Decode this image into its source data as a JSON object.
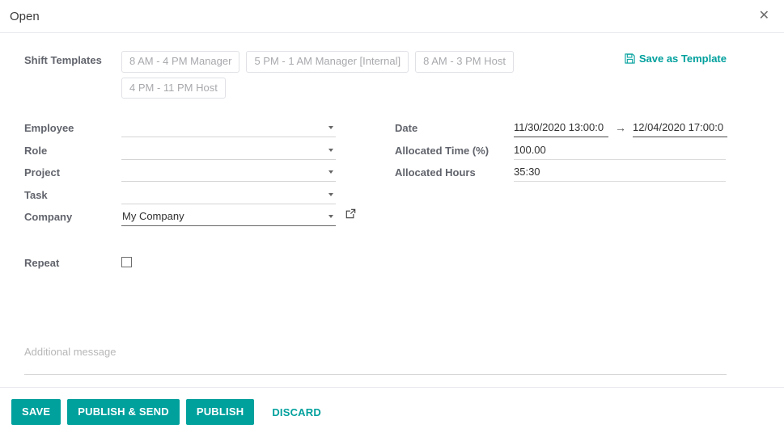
{
  "dialog": {
    "title": "Open",
    "close_icon": "close-icon",
    "close_glyph": "✕"
  },
  "shift_templates": {
    "label": "Shift Templates",
    "chips": [
      "8 AM - 4 PM Manager",
      "5 PM - 1 AM Manager [Internal]",
      "8 AM - 3 PM Host",
      "4 PM - 11 PM Host"
    ],
    "save_as_template": {
      "label": "Save as Template",
      "icon": "floppy-disk-save-icon"
    }
  },
  "form": {
    "left": [
      {
        "label": "Employee",
        "value": "",
        "type": "select"
      },
      {
        "label": "Role",
        "value": "",
        "type": "select"
      },
      {
        "label": "Project",
        "value": "",
        "type": "select"
      },
      {
        "label": "Task",
        "value": "",
        "type": "select"
      },
      {
        "label": "Company",
        "value": "My Company",
        "type": "select-filled"
      }
    ],
    "company_external_link_icon": "external-link-icon",
    "right": {
      "date": {
        "label": "Date",
        "start": "11/30/2020 13:00:0",
        "arrow": "→",
        "end": "12/04/2020 17:00:0"
      },
      "allocated_time": {
        "label": "Allocated Time (%)",
        "value": "100.00"
      },
      "allocated_hours": {
        "label": "Allocated Hours",
        "value": "35:30"
      }
    },
    "repeat": {
      "label": "Repeat",
      "checked": false
    },
    "message": {
      "placeholder": "Additional message"
    }
  },
  "footer": {
    "buttons": [
      {
        "label": "SAVE",
        "style": "primary"
      },
      {
        "label": "PUBLISH & SEND",
        "style": "primary"
      },
      {
        "label": "PUBLISH",
        "style": "primary"
      },
      {
        "label": "DISCARD",
        "style": "link"
      }
    ]
  },
  "colors": {
    "primary": "#00a09d",
    "label": "#61646c",
    "chip_text": "#a8a9ad",
    "border": "#e7e9ed"
  }
}
